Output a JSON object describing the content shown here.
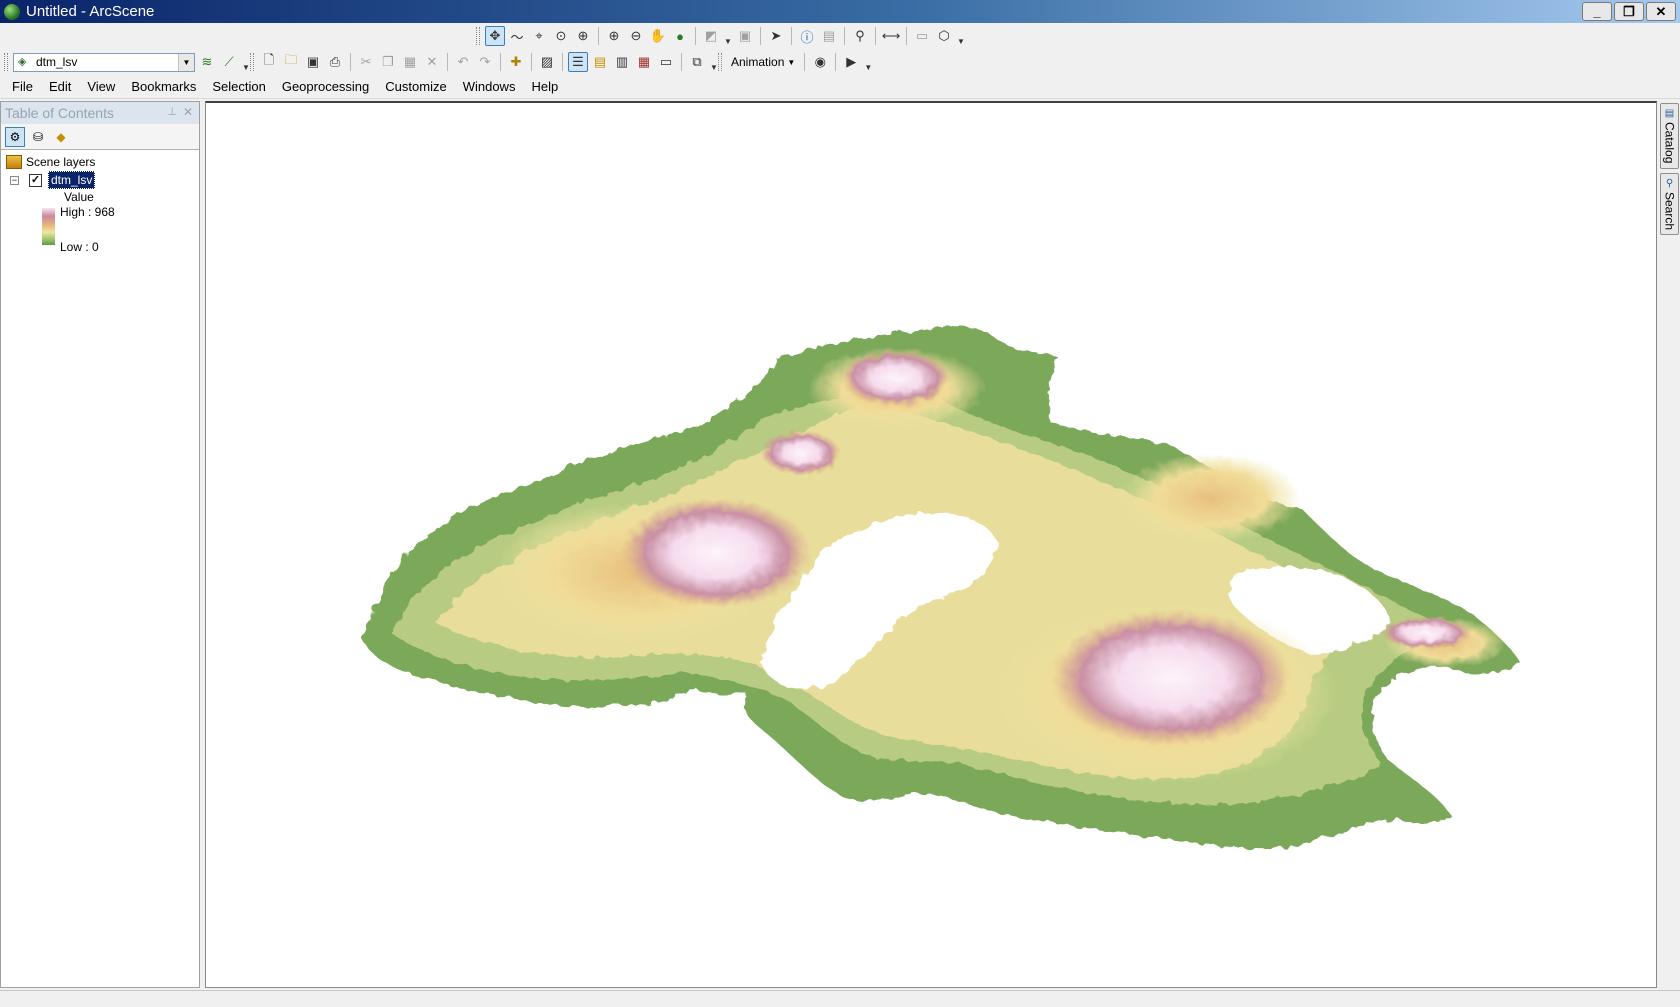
{
  "window": {
    "title": "Untitled - ArcScene",
    "controls": {
      "minimize": "_",
      "restore": "❐",
      "close": "✕"
    }
  },
  "toolbar_tools": {
    "layer_combo": "dtm_lsv",
    "animation_label": "Animation"
  },
  "menu": [
    "File",
    "Edit",
    "View",
    "Bookmarks",
    "Selection",
    "Geoprocessing",
    "Customize",
    "Windows",
    "Help"
  ],
  "toc": {
    "title": "Table of Contents",
    "root": "Scene layers",
    "layer": {
      "name": "dtm_lsv",
      "checked": true,
      "legend_field": "Value",
      "high": "High : 968",
      "low": "Low : 0"
    }
  },
  "dock_tabs": [
    "Catalog",
    "Search"
  ],
  "colors": {
    "elevation_low": "#6f9f4f",
    "elevation_mid": "#e8d890",
    "elevation_high": "#c89aa8",
    "elevation_peak": "#fbeff7"
  }
}
